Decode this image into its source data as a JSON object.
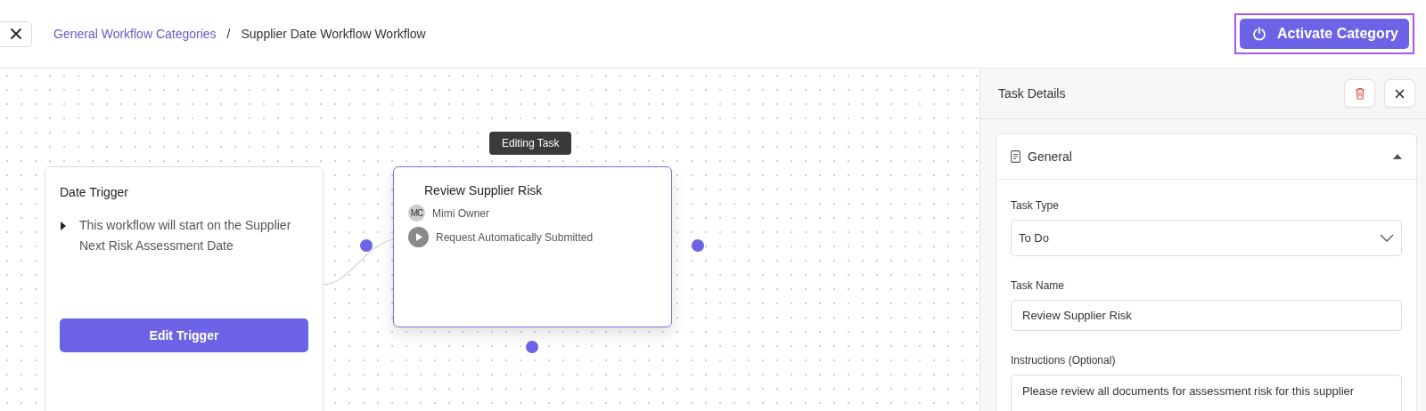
{
  "header": {
    "breadcrumb": [
      {
        "label": "General Workflow Categories",
        "kind": "link"
      },
      {
        "label": "/",
        "kind": "separator"
      },
      {
        "label": "Supplier Date Workflow Workflow",
        "kind": "current"
      }
    ],
    "primary_button": {
      "label": "Activate Category",
      "focused": true
    }
  },
  "canvas": {
    "trigger": {
      "title": "Date Trigger",
      "description": "This workflow will start on the Supplier Next Risk Assessment Date",
      "button": "Edit Trigger"
    },
    "task": {
      "tooltip": "Editing Task",
      "title": "Review Supplier Risk",
      "selected": true,
      "assignee": {
        "initials": "MC",
        "name": "Mimi Owner"
      },
      "action": "Request Automatically Submitted"
    }
  },
  "panel": {
    "title": "Task Details",
    "section": {
      "title": "General",
      "expanded": true,
      "fields": [
        {
          "kind": "select",
          "label": "Task Type",
          "value": "To Do"
        },
        {
          "kind": "input",
          "label": "Task Name",
          "value": "Review Supplier Risk"
        },
        {
          "kind": "textarea",
          "label": "Instructions (Optional)",
          "value": "Please review all documents for assessment risk for this supplier"
        }
      ]
    }
  }
}
